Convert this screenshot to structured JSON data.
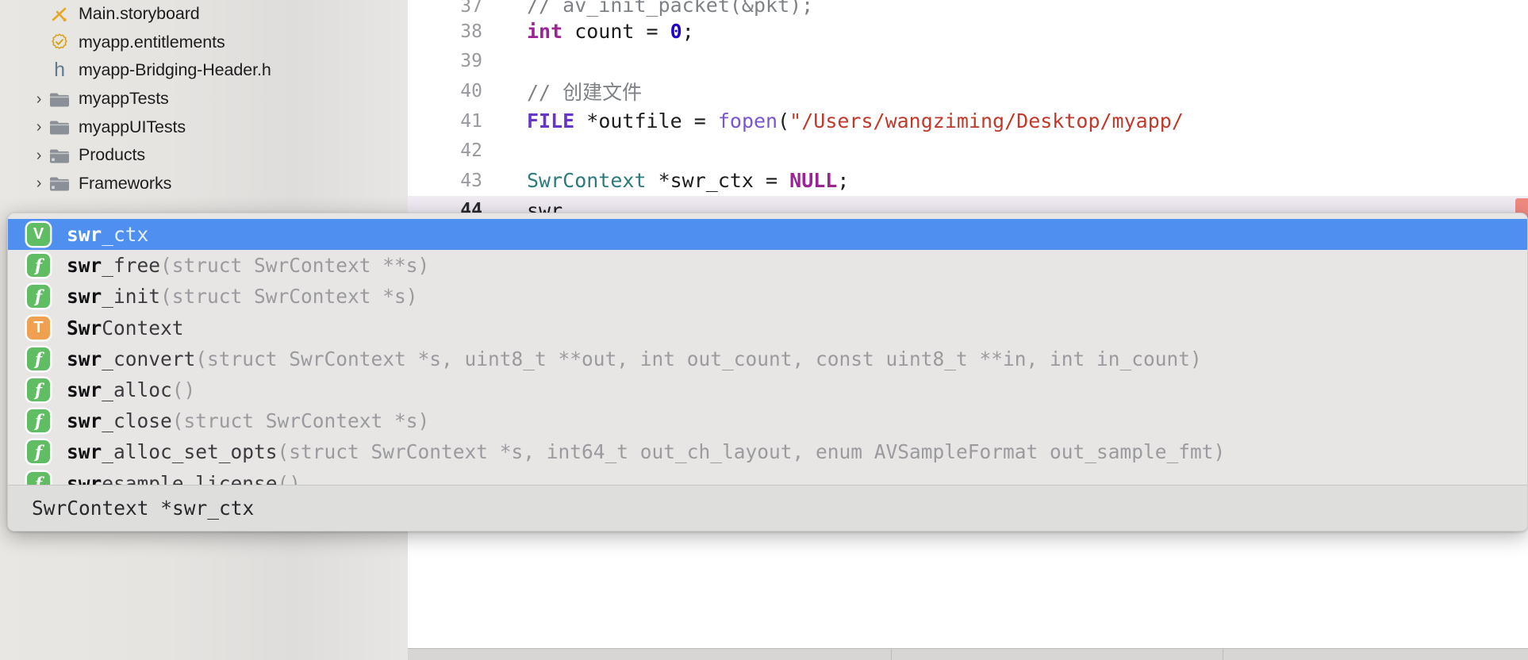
{
  "navigator": {
    "items": [
      {
        "label": "Main.storyboard",
        "icon": "storyboard-icon",
        "disclosure": "none"
      },
      {
        "label": "myapp.entitlements",
        "icon": "entitlements-icon",
        "disclosure": "none"
      },
      {
        "label": "myapp-Bridging-Header.h",
        "icon": "header-file-icon",
        "disclosure": "none"
      },
      {
        "label": "myappTests",
        "icon": "folder-icon",
        "disclosure": "collapsed"
      },
      {
        "label": "myappUITests",
        "icon": "folder-icon",
        "disclosure": "collapsed"
      },
      {
        "label": "Products",
        "icon": "folder-icon",
        "disclosure": "collapsed"
      },
      {
        "label": "Frameworks",
        "icon": "folder-icon",
        "disclosure": "collapsed"
      }
    ]
  },
  "editor": {
    "lines": [
      {
        "number": "37",
        "current": false
      },
      {
        "number": "38",
        "current": false
      },
      {
        "number": "39",
        "current": false
      },
      {
        "number": "40",
        "current": false
      },
      {
        "number": "41",
        "current": false
      },
      {
        "number": "42",
        "current": false
      },
      {
        "number": "43",
        "current": false
      },
      {
        "number": "44",
        "current": true
      }
    ],
    "line37": {
      "comment": "// av_init_packet(&pkt);"
    },
    "line38": {
      "kw": "int",
      "name": " count = ",
      "num": "0",
      "semi": ";"
    },
    "line40": {
      "comment": "// 创建文件"
    },
    "line41": {
      "type": "FILE",
      "mid": " *outfile = ",
      "fn": "fopen",
      "paren": "(",
      "str": "\"/Users/wangziming/Desktop/myapp/"
    },
    "line43": {
      "type": "SwrContext",
      "mid": " *swr_ctx = ",
      "kw": "NULL",
      "semi": ";"
    },
    "line44": {
      "text": "swr"
    }
  },
  "autocomplete": {
    "rows": [
      {
        "kind": "variable",
        "badge": "V",
        "prefix": "swr",
        "rest": "_ctx",
        "dim": "",
        "selected": true
      },
      {
        "kind": "function",
        "badge": "f",
        "prefix": "swr",
        "rest": "_free",
        "dim": "(struct SwrContext **s)",
        "selected": false
      },
      {
        "kind": "function",
        "badge": "f",
        "prefix": "swr",
        "rest": "_init",
        "dim": "(struct SwrContext *s)",
        "selected": false
      },
      {
        "kind": "type",
        "badge": "T",
        "prefix": "Swr",
        "rest": "Context",
        "dim": "",
        "selected": false
      },
      {
        "kind": "function",
        "badge": "f",
        "prefix": "swr",
        "rest": "_convert",
        "dim": "(struct SwrContext *s, uint8_t **out, int out_count, const uint8_t **in, int in_count)",
        "selected": false
      },
      {
        "kind": "function",
        "badge": "f",
        "prefix": "swr",
        "rest": "_alloc",
        "dim": "()",
        "selected": false
      },
      {
        "kind": "function",
        "badge": "f",
        "prefix": "swr",
        "rest": "_close",
        "dim": "(struct SwrContext *s)",
        "selected": false
      },
      {
        "kind": "function",
        "badge": "f",
        "prefix": "swr",
        "rest": "_alloc_set_opts",
        "dim": "(struct SwrContext *s, int64_t out_ch_layout, enum AVSampleFormat out_sample_fmt)",
        "selected": false
      },
      {
        "kind": "function",
        "badge": "f",
        "prefix": "swr",
        "rest": "esample_license",
        "dim": "()",
        "selected": false
      }
    ],
    "footer": "SwrContext *swr_ctx"
  },
  "colors": {
    "selection_blue": "#4f8ff0",
    "badge_green": "#60bd63",
    "badge_orange": "#efa050",
    "popup_bg": "#e7e6e5",
    "footer_bg": "#dededd",
    "navigator_bg": "#e6e4e1",
    "current_line": "#f0ebf3",
    "caret_marker": "#f08a80"
  }
}
